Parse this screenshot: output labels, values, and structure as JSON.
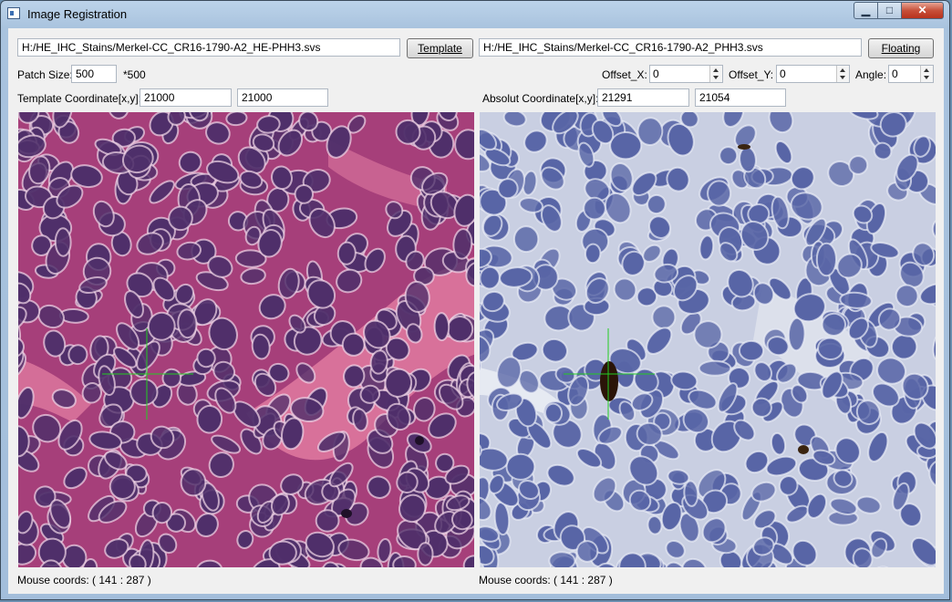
{
  "window": {
    "title": "Image Registration"
  },
  "template": {
    "path": "H:/HE_IHC_Stains/Merkel-CC_CR16-1790-A2_HE-PHH3.svs",
    "button_label": "Template",
    "coord_label": "Template Coordinate[x,y]:",
    "x": "21000",
    "y": "21000",
    "mouse_label": "Mouse coords: ( 141 : 287 )"
  },
  "floating": {
    "path": "H:/HE_IHC_Stains/Merkel-CC_CR16-1790-A2_PHH3.svs",
    "button_label": "Floating",
    "coord_label": "Absolut Coordinate[x,y]:",
    "x": "21291",
    "y": "21054",
    "mouse_label": "Mouse coords: ( 141 : 287 )"
  },
  "patch": {
    "label": "Patch Size:",
    "value": "500",
    "suffix": "*500"
  },
  "offsets": {
    "x_label": "Offset_X:",
    "x_value": "0",
    "y_label": "Offset_Y:",
    "y_value": "0",
    "angle_label": "Angle:",
    "angle_value": "0"
  },
  "colors": {
    "he_background": "#a63f7a",
    "he_nucleus": "#4f2f6a",
    "he_stroma": "#e07aa0",
    "ihc_background": "#c9cfe2",
    "ihc_nucleus": "#5865a6",
    "crosshair": "#22cc22"
  }
}
